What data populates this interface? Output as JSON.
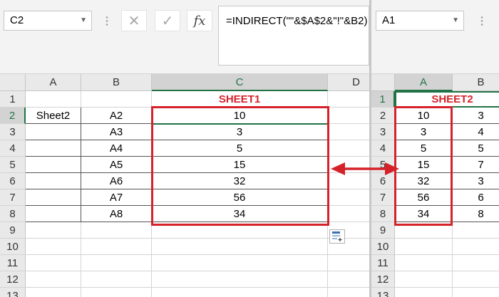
{
  "left": {
    "namebox": "C2",
    "formula": "=INDIRECT(\"\"&$A$2&\"!\"&B2)",
    "columns": [
      "A",
      "B",
      "C",
      "D"
    ],
    "rows": [
      "1",
      "2",
      "3",
      "4",
      "5",
      "6",
      "7",
      "8",
      "9",
      "10",
      "11",
      "12",
      "13"
    ],
    "title": "SHEET1",
    "cells": [
      {
        "a": "Sheet2",
        "b": "A2",
        "c": "10"
      },
      {
        "a": "",
        "b": "A3",
        "c": "3"
      },
      {
        "a": "",
        "b": "A4",
        "c": "5"
      },
      {
        "a": "",
        "b": "A5",
        "c": "15"
      },
      {
        "a": "",
        "b": "A6",
        "c": "32"
      },
      {
        "a": "",
        "b": "A7",
        "c": "56"
      },
      {
        "a": "",
        "b": "A8",
        "c": "34"
      }
    ]
  },
  "right": {
    "namebox": "A1",
    "columns": [
      "A",
      "B"
    ],
    "rows": [
      "1",
      "2",
      "3",
      "4",
      "5",
      "6",
      "7",
      "8",
      "9",
      "10",
      "11",
      "12",
      "13"
    ],
    "title": "SHEET2",
    "cells": [
      {
        "a": "10",
        "b": "3"
      },
      {
        "a": "3",
        "b": "4"
      },
      {
        "a": "5",
        "b": "5"
      },
      {
        "a": "15",
        "b": "7"
      },
      {
        "a": "32",
        "b": "3"
      },
      {
        "a": "56",
        "b": "6"
      },
      {
        "a": "34",
        "b": "8"
      }
    ]
  },
  "colors": {
    "annotation": "#d5222a",
    "selection": "#217346"
  },
  "icons": [
    "cancel-icon",
    "enter-check-icon",
    "insert-function-icon",
    "paste-options-icon"
  ]
}
